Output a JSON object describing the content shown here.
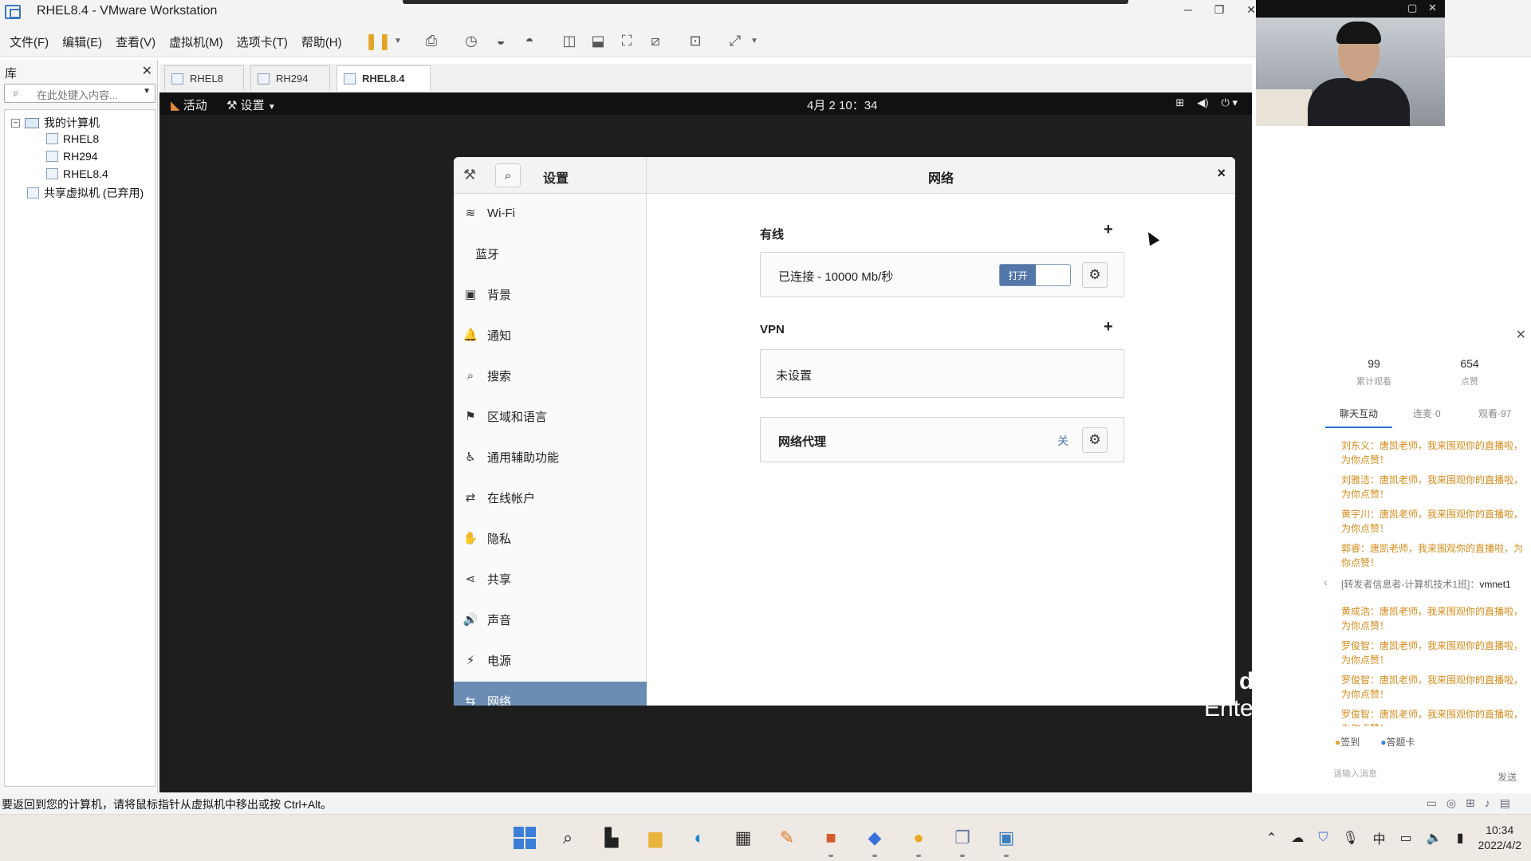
{
  "window": {
    "title": "RHEL8.4 - VMware Workstation",
    "minimize": "─",
    "maximize": "❐",
    "close": "✕"
  },
  "menu": [
    "文件(F)",
    "编辑(E)",
    "查看(V)",
    "虚拟机(M)",
    "选项卡(T)",
    "帮助(H)"
  ],
  "toolbar_icons": [
    "pause-icon",
    "send-keys-icon",
    "snapshot-icon",
    "revert-snapshot-icon",
    "snapshot-manager-icon",
    "library-view-icon",
    "thumbnail-view-icon",
    "fullscreen-icon",
    "unity-icon",
    "console-icon",
    "stretch-icon"
  ],
  "library": {
    "title": "库",
    "close": "✕",
    "search_placeholder": "在此处键入内容...",
    "tree": {
      "root": "我的计算机",
      "vms": [
        "RHEL8",
        "RH294",
        "RHEL8.4"
      ],
      "shared": "共享虚拟机 (已弃用)"
    }
  },
  "vm_tabs": [
    "RHEL8",
    "RH294",
    "RHEL8.4"
  ],
  "gnome": {
    "activities": "活动",
    "app_menu": "设置",
    "clock": "4月 2  10：34",
    "brand_line1": "d Hat",
    "brand_line2": "Enterprise"
  },
  "settings": {
    "left_title": "设置",
    "main_title": "网络",
    "close": "×",
    "sidebar": [
      {
        "label": "Wi-Fi",
        "icon": "wifi-icon",
        "glyph": "≋"
      },
      {
        "label": "蓝牙",
        "icon": "",
        "glyph": ""
      },
      {
        "label": "背景",
        "icon": "background-icon",
        "glyph": "▣"
      },
      {
        "label": "通知",
        "icon": "bell-icon",
        "glyph": "🔔"
      },
      {
        "label": "搜索",
        "icon": "search-icon",
        "glyph": "⌕"
      },
      {
        "label": "区域和语言",
        "icon": "flag-icon",
        "glyph": "⚑"
      },
      {
        "label": "通用辅助功能",
        "icon": "accessibility-icon",
        "glyph": "♿"
      },
      {
        "label": "在线帐户",
        "icon": "online-accounts-icon",
        "glyph": "⇄"
      },
      {
        "label": "隐私",
        "icon": "hand-icon",
        "glyph": "✋"
      },
      {
        "label": "共享",
        "icon": "share-icon",
        "glyph": "⋖"
      },
      {
        "label": "声音",
        "icon": "speaker-icon",
        "glyph": "🔊"
      },
      {
        "label": "电源",
        "icon": "power-icon",
        "glyph": "⚡"
      },
      {
        "label": "网络",
        "icon": "network-icon",
        "glyph": "⇆"
      }
    ],
    "wired": {
      "label": "有线",
      "add": "+",
      "status": "已连接 - 10000 Mb/秒",
      "toggle_on_label": "打开",
      "toggle_state": "on"
    },
    "vpn": {
      "label": "VPN",
      "add": "+",
      "status": "未设置"
    },
    "proxy": {
      "label": "网络代理",
      "status": "关"
    }
  },
  "chat": {
    "close": "✕",
    "stats": [
      {
        "num": "99",
        "label": "累计观看"
      },
      {
        "num": "654",
        "label": "点赞"
      }
    ],
    "tabs": [
      "聊天互动",
      "连麦·0",
      "观看·97"
    ],
    "messages": [
      {
        "text": "刘东义：唐凯老师，我来围观你的直播啦，为你点赞！",
        "type": "user"
      },
      {
        "text": "刘雅洁：唐凯老师，我来围观你的直播啦，为你点赞！",
        "type": "user"
      },
      {
        "text": "黄宇川：唐凯老师，我来围观你的直播啦，为你点赞！",
        "type": "user"
      },
      {
        "text": "郭睿：唐凯老师，我来围观你的直播啦，为你点赞！",
        "type": "user"
      },
      {
        "text": "[转发者信息者-计算机技术1班]：",
        "bold": "vmnet1",
        "type": "sys"
      },
      {
        "text": "黄成浩：唐凯老师，我来围观你的直播啦，为你点赞！",
        "type": "user"
      },
      {
        "text": "罗俊智：唐凯老师，我来围观你的直播啦，为你点赞！",
        "type": "user"
      },
      {
        "text": "罗俊智：唐凯老师，我来围观你的直播啦，为你点赞！",
        "type": "user"
      },
      {
        "text": "罗俊智：唐凯老师，我来围观你的直播啦，为你点赞！",
        "type": "user"
      }
    ],
    "actions": [
      "签到",
      "答题卡"
    ],
    "input_placeholder": "请输入消息",
    "send": "发送"
  },
  "statusbar": {
    "message": "要返回到您的计算机，请将鼠标指针从虚拟机中移出或按 Ctrl+Alt。"
  },
  "taskbar": {
    "apps": [
      "start-icon",
      "search-icon",
      "task-view-icon",
      "file-explorer-icon",
      "edge-icon",
      "store-icon",
      "paint-icon",
      "powerpoint-icon",
      "feishu-icon",
      "chat-app-icon",
      "vmware-icon",
      "remote-desktop-icon"
    ],
    "ime": "中",
    "time": "10:34",
    "date": "2022/4/2"
  },
  "colors": {
    "accent": "#5277a8",
    "sidebar_active": "#6b8db3",
    "chat_user_text": "#d58c1c",
    "pause_icon": "#e3a324"
  }
}
